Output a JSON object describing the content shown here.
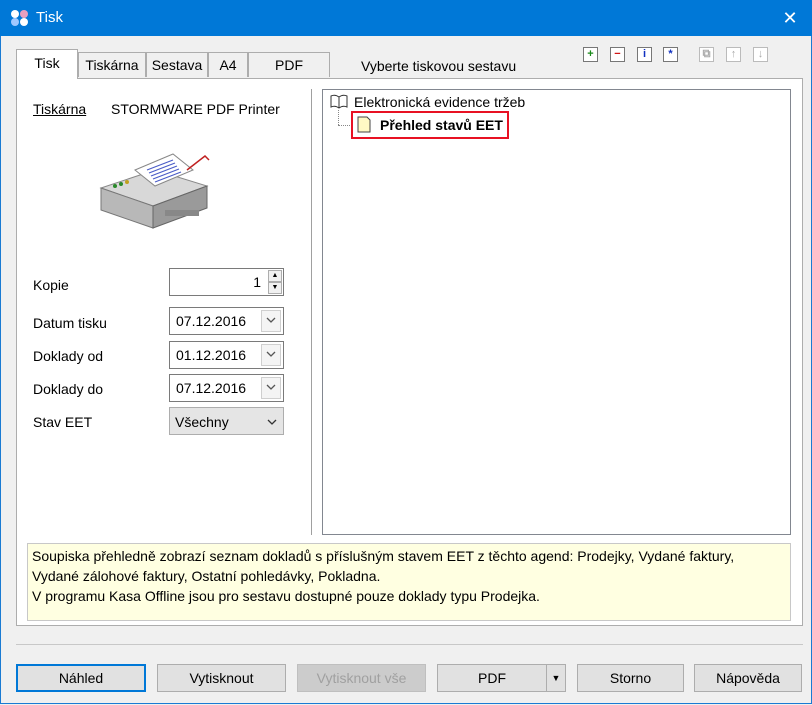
{
  "window": {
    "title": "Tisk",
    "close_glyph": "✕"
  },
  "tabs": [
    {
      "label": "Tisk"
    },
    {
      "label": "Tiskárna"
    },
    {
      "label": "Sestava"
    },
    {
      "label": "A4"
    },
    {
      "label": "PDF"
    }
  ],
  "report_prompt": "Vyberte tiskovou sestavu",
  "toolbar_icons": [
    "add-icon",
    "remove-icon",
    "info-icon",
    "asterisk-icon",
    "copy-icon",
    "move-up-icon",
    "move-down-icon"
  ],
  "printer": {
    "label": "Tiskárna",
    "name": "STORMWARE PDF Printer"
  },
  "form": {
    "kopie": {
      "label": "Kopie",
      "value": "1"
    },
    "datum_tisku": {
      "label": "Datum tisku",
      "value": "07.12.2016"
    },
    "doklady_od": {
      "label": "Doklady od",
      "value": "01.12.2016"
    },
    "doklady_do": {
      "label": "Doklady do",
      "value": "07.12.2016"
    },
    "stav_eet": {
      "label": "Stav EET",
      "value": "Všechny"
    }
  },
  "tree": {
    "root": "Elektronická evidence tržeb",
    "child": "Přehled stavů EET"
  },
  "description": [
    "Soupiska přehledně zobrazí seznam dokladů s příslušným stavem EET z těchto agend: Prodejky, Vydané faktury,",
    "Vydané zálohové faktury, Ostatní pohledávky, Pokladna.",
    "V programu Kasa Offline jsou pro sestavu dostupné pouze doklady typu Prodejka."
  ],
  "buttons": {
    "nahled": "Náhled",
    "vytisknout": "Vytisknout",
    "vytisknout_vse": "Vytisknout vše",
    "pdf": "PDF",
    "storno": "Storno",
    "napoveda": "Nápověda"
  },
  "colors": {
    "titlebar": "#0078d7",
    "highlight_border": "#e81123",
    "description_bg": "#ffffe1"
  }
}
